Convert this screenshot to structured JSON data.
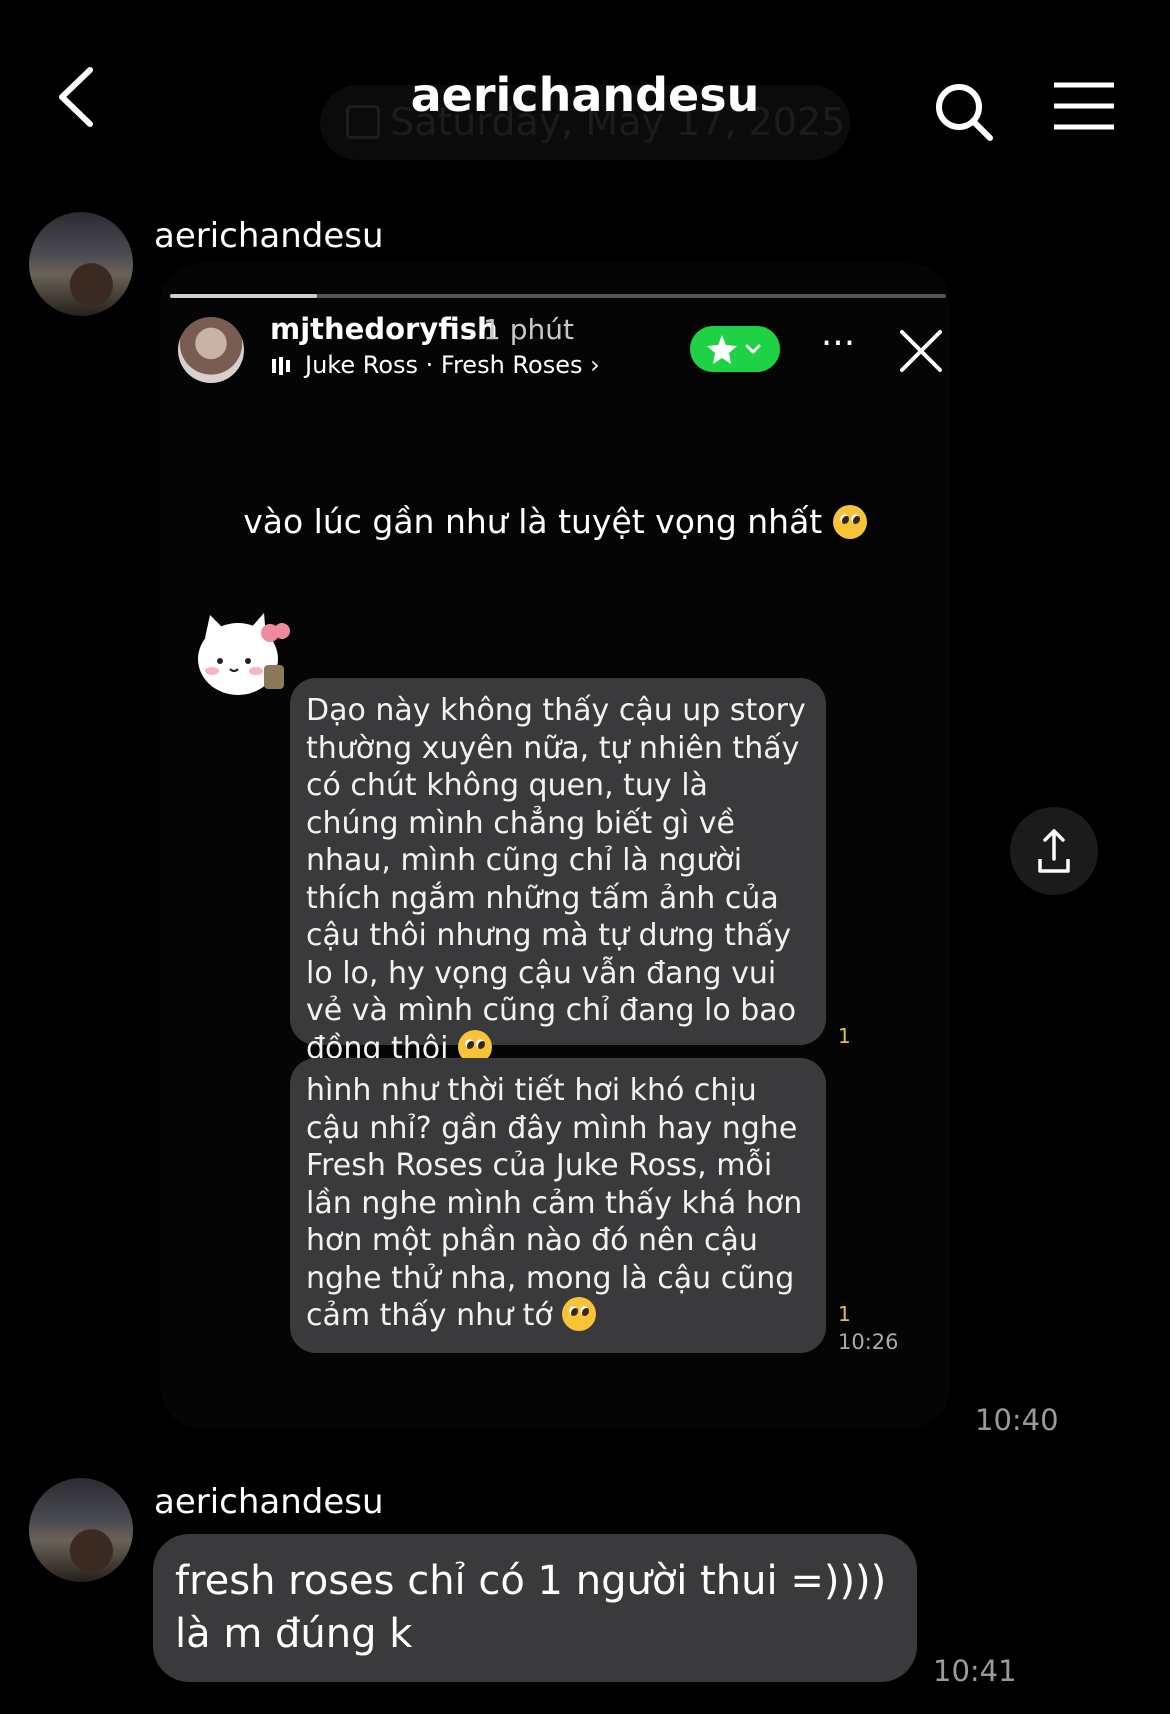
{
  "header": {
    "title": "aerichandesu",
    "ghost_date": "Saturday, May 17, 2025"
  },
  "messages": [
    {
      "sender": "aerichandesu"
    },
    {
      "sender": "aerichandesu",
      "text": "fresh roses chỉ có 1 người thui =)))) là m đúng k"
    }
  ],
  "story": {
    "username": "mjthedoryfish",
    "time_ago": "1 phút",
    "music": "Juke Ross · Fresh Roses ›",
    "caption": "vào lúc gần như là tuyệt vọng nhất",
    "inner_messages": [
      {
        "text": "Dạo này không thấy cậu up story thường xuyên nữa, tự nhiên thấy có chút không quen, tuy là chúng mình chẳng biết gì về nhau, mình cũng chỉ là người thích ngắm những tấm ảnh của cậu thôi nhưng mà tự dưng thấy lo lo, hy vọng cậu vẫn đang vui vẻ và mình cũng chỉ đang lo bao đồng thôi",
        "read_count": "1"
      },
      {
        "text": "hình như thời tiết hơi khó chịu cậu nhỉ? gần đây mình hay nghe Fresh Roses của Juke Ross, mỗi lần nghe mình cảm thấy khá hơn hơn một phần nào đó nên cậu nghe thử nha, mong là cậu cũng cảm thấy như tớ",
        "read_count": "1"
      }
    ],
    "inner_time": "10:26",
    "progress": 0.19
  },
  "timestamps": {
    "story_share": "10:40",
    "reply": "10:41"
  },
  "colors": {
    "background": "#000000",
    "bubble": "#3a3a3c",
    "accent_green": "#1fd145",
    "timestamp": "#9a9a9a"
  },
  "icons": [
    "back-icon",
    "search-icon",
    "menu-icon",
    "calendar-icon",
    "music-bars-icon",
    "star-icon",
    "more-icon",
    "close-icon",
    "share-icon",
    "pleading-face-emoji"
  ]
}
